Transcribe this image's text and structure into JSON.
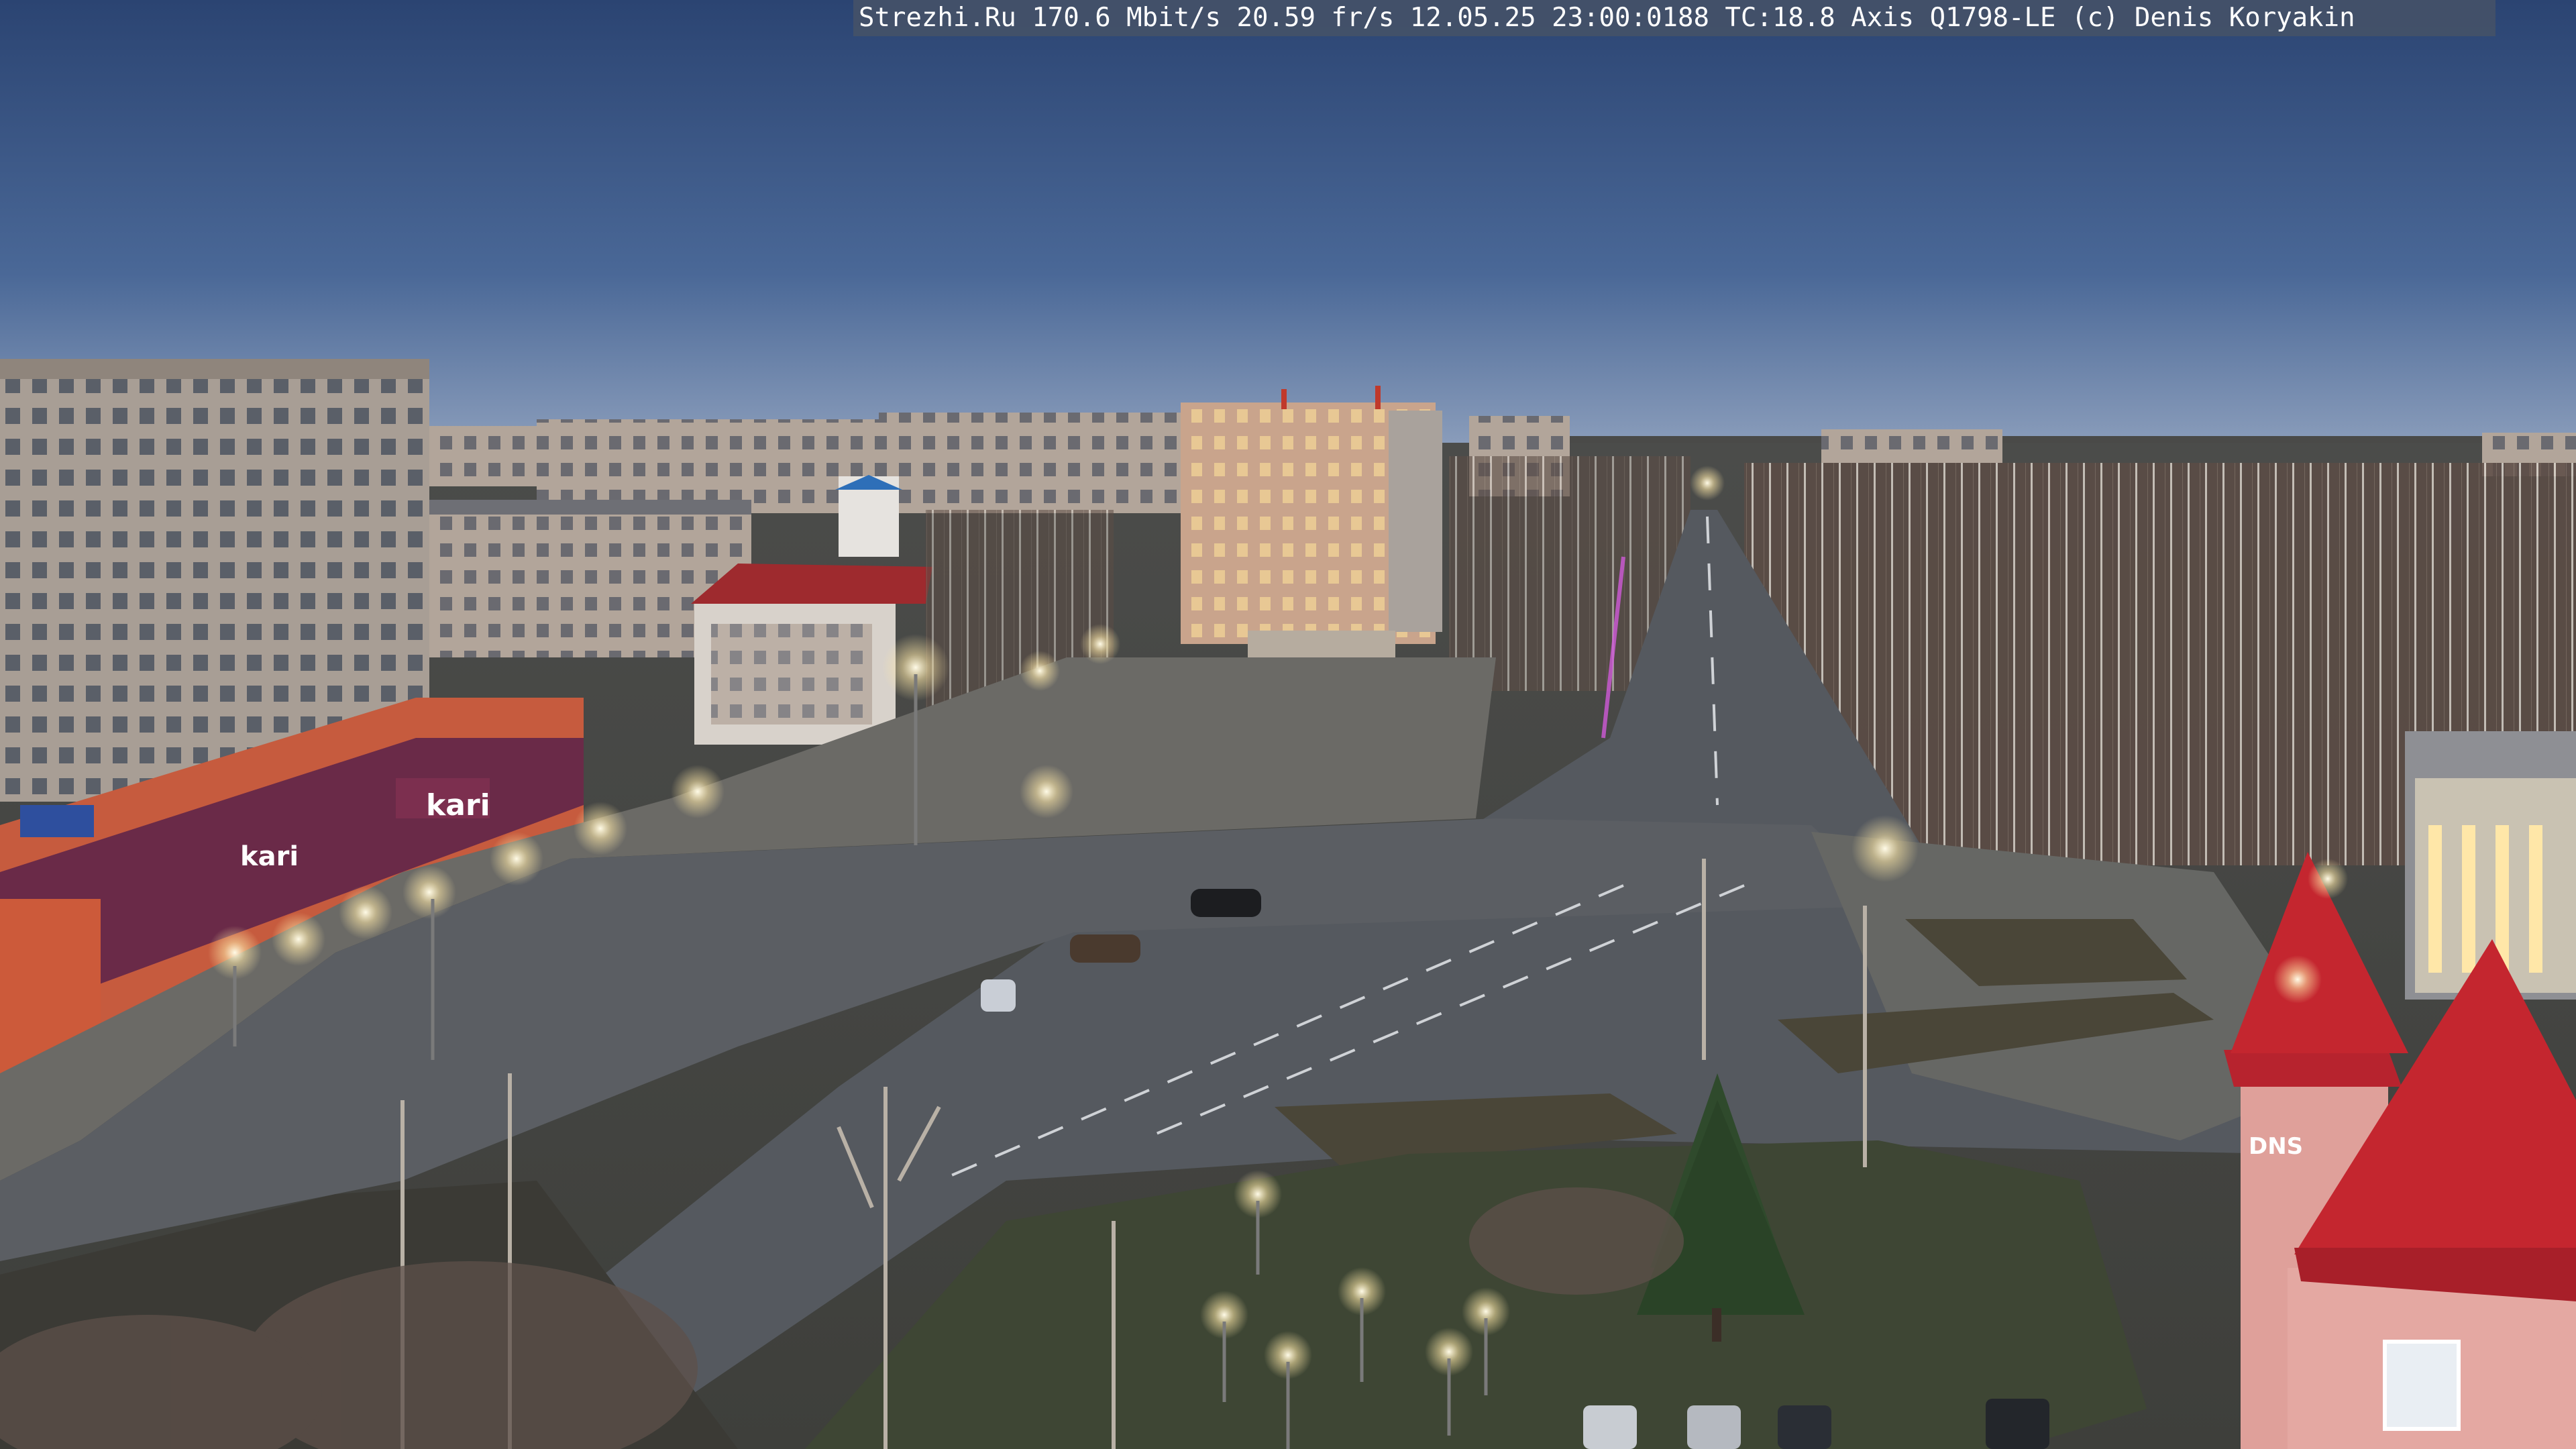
{
  "overlay": {
    "text": "Strezhi.Ru 170.6 Mbit/s 20.59 fr/s 12.05.25 23:00:0188 TC:18.8  Axis Q1798-LE  (c) Denis Koryakin"
  },
  "signage": {
    "store_sign": "kari",
    "store_sign_2": "kari",
    "side_sign": "DNS"
  },
  "colors": {
    "sky_top": "#2b4472",
    "sky_horizon": "#8ea0bd",
    "road": "#55595f",
    "plaza": "#6b6a66",
    "roof_red": "#b7232e",
    "lamp": "#fff6d8"
  }
}
